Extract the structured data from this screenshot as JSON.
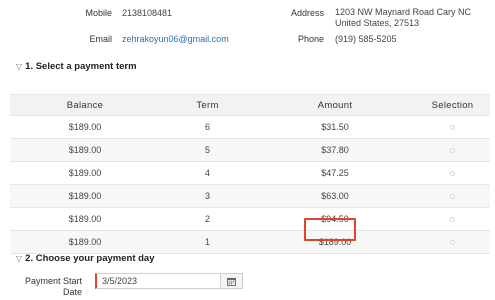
{
  "contact": {
    "mobile_label": "Mobile",
    "mobile_value": "2138108481",
    "email_label": "Email",
    "email_value": "zehrakoyun06@gmail.com",
    "address_label": "Address",
    "address_line1": "1203 NW Maynard Road Cary NC",
    "address_line2": "United States, 27513",
    "phone_label": "Phone",
    "phone_value": "(919) 585-5205"
  },
  "section1": {
    "title": "1. Select a payment term"
  },
  "table": {
    "headers": {
      "balance": "Balance",
      "term": "Term",
      "amount": "Amount",
      "selection": "Selection"
    },
    "rows": [
      {
        "balance": "$189.00",
        "term": "6",
        "amount": "$31.50"
      },
      {
        "balance": "$189.00",
        "term": "5",
        "amount": "$37.80"
      },
      {
        "balance": "$189.00",
        "term": "4",
        "amount": "$47.25"
      },
      {
        "balance": "$189.00",
        "term": "3",
        "amount": "$63.00"
      },
      {
        "balance": "$189.00",
        "term": "2",
        "amount": "$94.50"
      },
      {
        "balance": "$189.00",
        "term": "1",
        "amount": "$189.00"
      }
    ]
  },
  "section2": {
    "title": "2. Choose your payment day"
  },
  "payment_day": {
    "label_line1": "Payment Start",
    "label_line2": "Date",
    "value": "3/5/2023"
  },
  "colors": {
    "highlight": "#e0442c",
    "link": "#2a6fb8"
  }
}
